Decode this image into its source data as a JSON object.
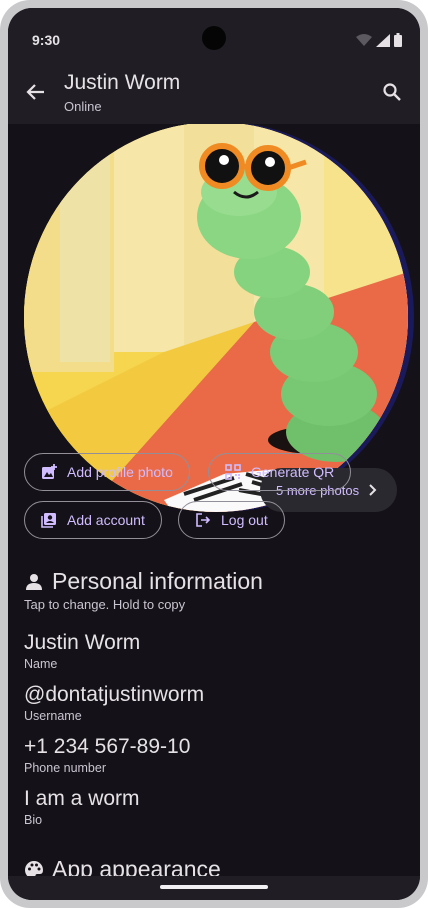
{
  "status_bar": {
    "time": "9:30"
  },
  "app_bar": {
    "title": "Justin Worm",
    "subtitle": "Online"
  },
  "photos": {
    "more_label": "5 more photos"
  },
  "actions": {
    "add_profile_photo": "Add profile photo",
    "generate_qr": "Generate QR",
    "add_account": "Add account",
    "log_out": "Log out"
  },
  "personal_info": {
    "heading": "Personal information",
    "hint": "Tap to change. Hold to copy",
    "fields": [
      {
        "value": "Justin Worm",
        "label": "Name"
      },
      {
        "value": "@dontatjustinworm",
        "label": "Username"
      },
      {
        "value": "+1 234 567-89-10",
        "label": "Phone number"
      },
      {
        "value": "I am a worm",
        "label": "Bio"
      }
    ]
  },
  "app_appearance": {
    "heading": "App appearance"
  },
  "colors": {
    "background": "#141218",
    "surface": "#201e24",
    "accent": "#d0bcff",
    "outline": "#938f99"
  }
}
